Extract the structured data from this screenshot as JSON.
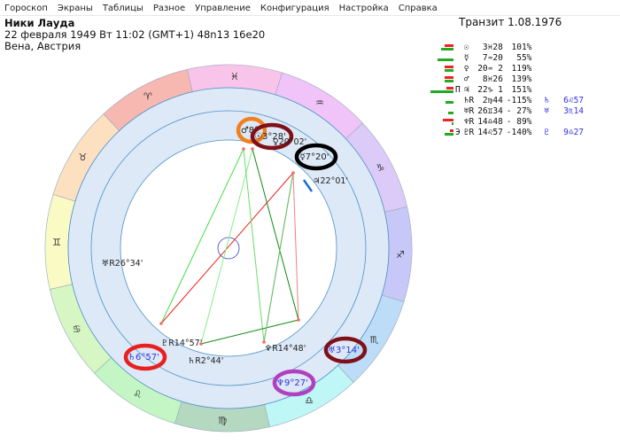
{
  "menu": [
    "Гороскоп",
    "Экраны",
    "Таблицы",
    "Разное",
    "Управление",
    "Конфигурация",
    "Настройка",
    "Справка"
  ],
  "header": {
    "name": "Ники Лауда",
    "datetime": "22 февраля 1949  Вт  11:02 (GMT+1) 48n13  16e20",
    "place": "Вена, Австрия"
  },
  "transit_title": "Транзит  1.08.1976",
  "colors": {
    "red": "#ee2222",
    "green": "#22aa22",
    "transit_text": "#3030e0"
  },
  "planets": [
    {
      "mark": "",
      "glyph": "☉",
      "pos": " 3♓28",
      "pct": " 101%",
      "tglyph": "",
      "tpos": "",
      "red": 0.5,
      "green": 0.7
    },
    {
      "mark": "",
      "glyph": "☿",
      "pos": " 7♒20",
      "pct": "  55%",
      "tglyph": "",
      "tpos": "",
      "red": 0,
      "green": 0.9
    },
    {
      "mark": "",
      "glyph": "♀",
      "pos": "20♒ 2",
      "pct": " 119%",
      "tglyph": "",
      "tpos": "",
      "red": 0.5,
      "green": 0.5
    },
    {
      "mark": "",
      "glyph": "♂",
      "pos": " 8♓26",
      "pct": " 139%",
      "tglyph": "",
      "tpos": "",
      "red": 0.5,
      "green": 0.5
    },
    {
      "mark": "Π",
      "glyph": "♃",
      "pos": "22♑ 1",
      "pct": " 151%",
      "tglyph": "",
      "tpos": "",
      "red": 0.4,
      "green": 1.3
    },
    {
      "mark": "",
      "glyph": "♄R",
      "pos": " 2♍44",
      "pct": "-115%",
      "tglyph": "♄",
      "tpos": "6♌57",
      "red": 0,
      "green": 0.45
    },
    {
      "mark": "",
      "glyph": "♅R",
      "pos": "26♊34",
      "pct": "- 27%",
      "tglyph": "♅",
      "tpos": "3♏14",
      "red": 0,
      "green": 0.3
    },
    {
      "mark": "",
      "glyph": "♆R",
      "pos": "14♎48",
      "pct": "- 89%",
      "tglyph": "",
      "tpos": "",
      "red": 0.6,
      "green": 0.1
    },
    {
      "mark": "Э",
      "glyph": "♇R",
      "pos": "14♌57",
      "pct": "-140%",
      "tglyph": "♇",
      "tpos": "9♎27",
      "red": 0.2,
      "green": 0.5
    }
  ],
  "zodiac": [
    {
      "glyph": "♈",
      "color": "#f7b8b2"
    },
    {
      "glyph": "♉",
      "color": "#fde0c0"
    },
    {
      "glyph": "♊",
      "color": "#fafac4"
    },
    {
      "glyph": "♋",
      "color": "#d6f7c4"
    },
    {
      "glyph": "♌",
      "color": "#c4f5c4"
    },
    {
      "glyph": "♍",
      "color": "#b4d8c0"
    },
    {
      "glyph": "♎",
      "color": "#bff7f7"
    },
    {
      "glyph": "♏",
      "color": "#bcdcf8"
    },
    {
      "glyph": "♐",
      "color": "#c8c8f8"
    },
    {
      "glyph": "♑",
      "color": "#dccaf8"
    },
    {
      "glyph": "♒",
      "color": "#f0c4f8"
    },
    {
      "glyph": "♓",
      "color": "#f8c4ea"
    }
  ],
  "chart_labels": {
    "transit": [
      {
        "text": "♂8°",
        "ring": "#f08020"
      },
      {
        "text": "☉3°28'",
        "ring": "#801018"
      },
      {
        "text": "☿7°20'",
        "ring": "#000000"
      },
      {
        "text": "♅3°14'",
        "ring": "#801018"
      },
      {
        "text": "♆9°27'",
        "ring": "#b040c0"
      },
      {
        "text": "♄6°57'",
        "ring": "#e82020"
      }
    ],
    "natal": [
      "♀20°02'",
      "♃22°01'",
      "♅R26°34'",
      "♇R14°57'",
      "♄R2°44'",
      "♆R14°48'"
    ]
  }
}
